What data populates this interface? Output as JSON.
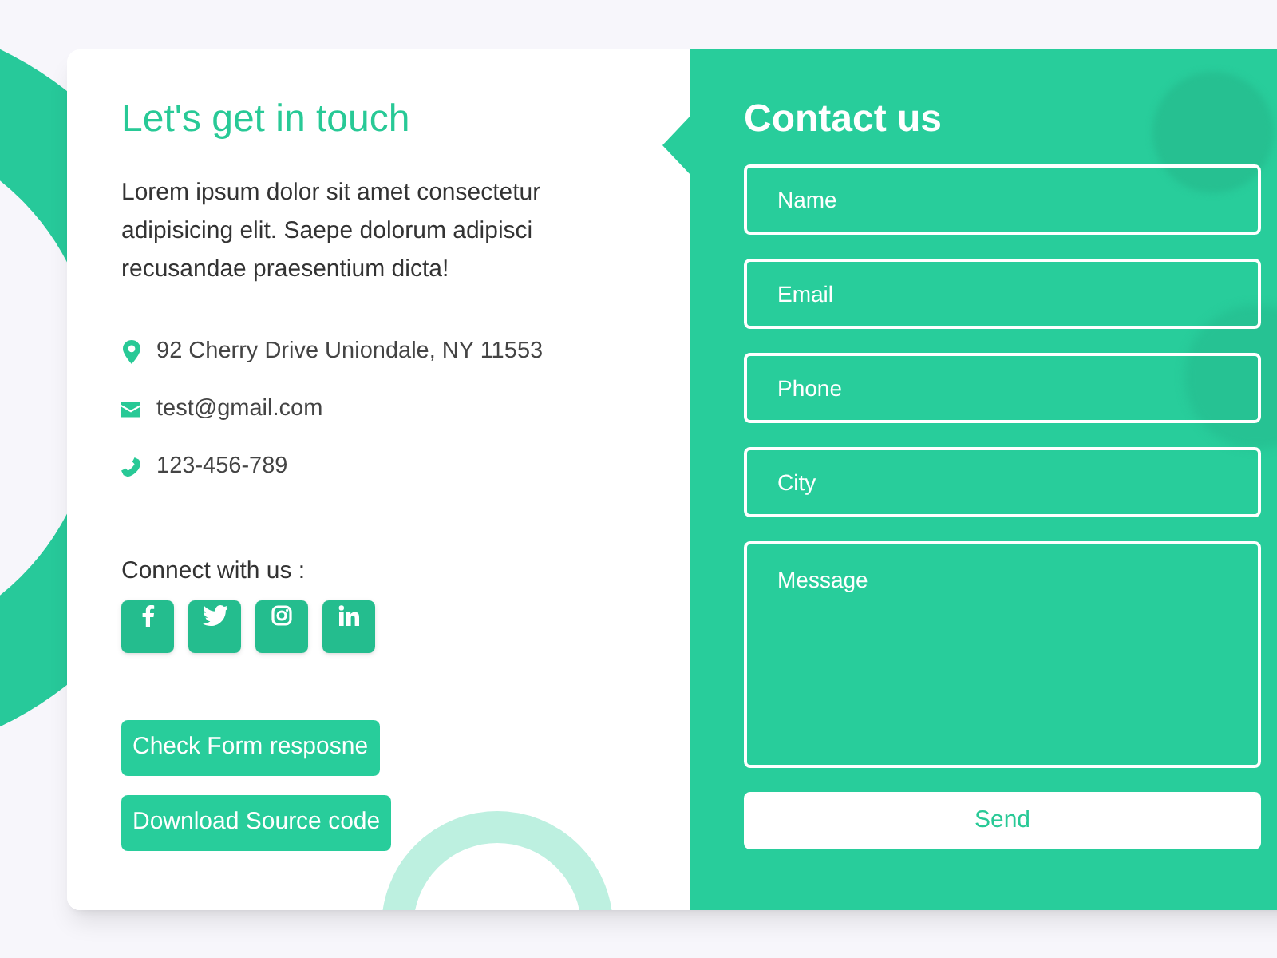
{
  "info": {
    "title": "Let's get in touch",
    "description": "Lorem ipsum dolor sit amet consectetur adipisicing elit. Saepe dolorum adipisci recusandae praesentium dicta!",
    "contacts": [
      {
        "kind": "address",
        "text": "92 Cherry Drive Uniondale, NY 11553"
      },
      {
        "kind": "email",
        "text": "test@gmail.com"
      },
      {
        "kind": "phone",
        "text": "123-456-789"
      }
    ],
    "connect_label": "Connect with us :",
    "socials": [
      {
        "kind": "facebook"
      },
      {
        "kind": "twitter"
      },
      {
        "kind": "instagram"
      },
      {
        "kind": "linkedin"
      }
    ],
    "buttons": [
      "Check Form resposne",
      "Download Source code"
    ]
  },
  "form": {
    "title": "Contact us",
    "fields": [
      {
        "kind": "input",
        "placeholder": "Name"
      },
      {
        "kind": "input",
        "placeholder": "Email"
      },
      {
        "kind": "input",
        "placeholder": "Phone"
      },
      {
        "kind": "input",
        "placeholder": "City"
      },
      {
        "kind": "textarea",
        "placeholder": "Message"
      }
    ],
    "submit": "Send"
  }
}
